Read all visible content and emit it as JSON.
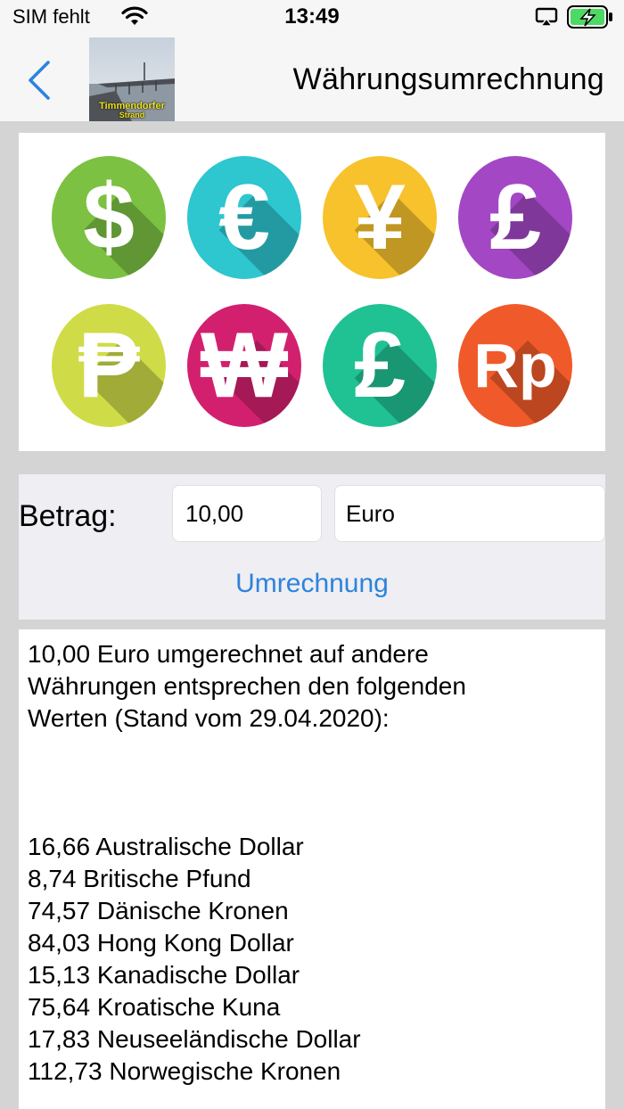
{
  "status_bar": {
    "carrier": "SIM fehlt",
    "time": "13:49",
    "icons": [
      "wifi-icon",
      "airplay-icon",
      "battery-charging-icon"
    ]
  },
  "nav": {
    "back_icon": "chevron-left-icon",
    "thumbnail_label_line1": "Timmendorfer",
    "thumbnail_label_line2": "Strand",
    "title": "Währungsumrechnung"
  },
  "banner": {
    "coins": [
      {
        "symbol": "$",
        "color": "#7cc142"
      },
      {
        "symbol": "€",
        "color": "#2ec6cf"
      },
      {
        "symbol": "¥",
        "color": "#f7c22c"
      },
      {
        "symbol": "£",
        "color": "#a347c4"
      },
      {
        "symbol": "₱",
        "color": "#cfdc48"
      },
      {
        "symbol": "₩",
        "color": "#d2206f"
      },
      {
        "symbol": "£",
        "color": "#20c193"
      },
      {
        "symbol": "Rp",
        "color": "#f05a2a"
      }
    ]
  },
  "form": {
    "amount_label": "Betrag:",
    "amount_value": "10,00",
    "currency_value": "Euro",
    "convert_label": "Umrechnung",
    "accent": "#2d83dc"
  },
  "result": {
    "intro_line1": "10,00 Euro umgerechnet auf andere",
    "intro_line2": "Währungen entsprechen den folgenden",
    "intro_line3": "Werten (Stand vom 29.04.2020):",
    "rates": [
      "16,66 Australische Dollar",
      "8,74 Britische Pfund",
      "74,57 Dänische Kronen",
      "84,03 Hong Kong Dollar",
      "15,13 Kanadische Dollar",
      "75,64 Kroatische Kuna",
      "17,83 Neuseeländische Dollar",
      "112,73 Norwegische Kronen"
    ]
  }
}
